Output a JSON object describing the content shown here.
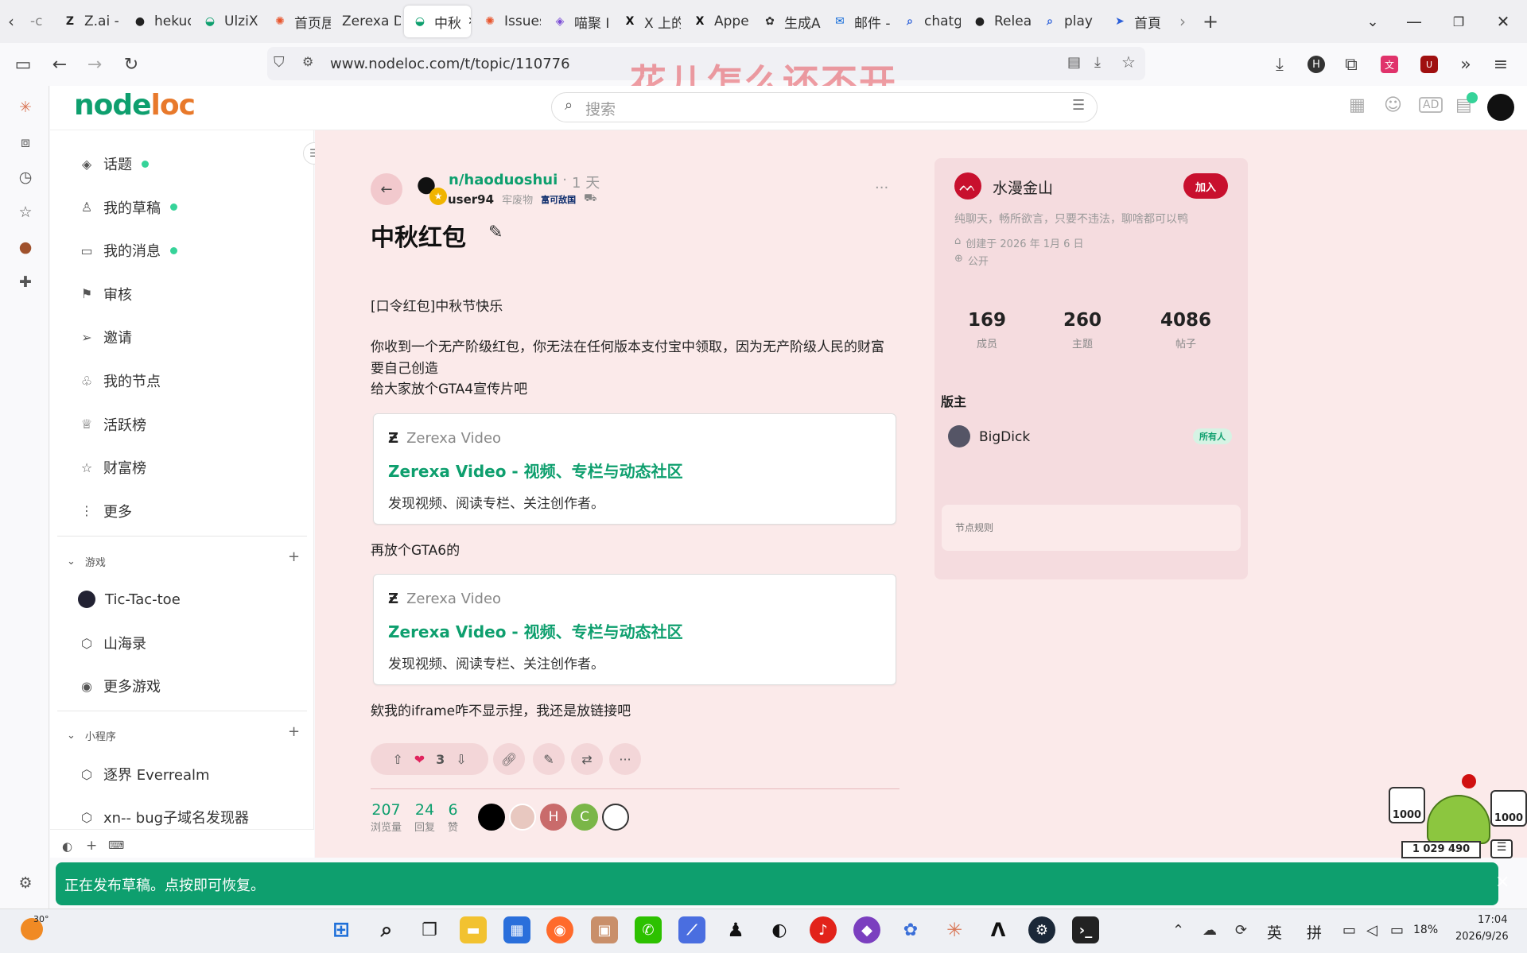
{
  "browser": {
    "tabs": [
      {
        "label": "Z.ai -",
        "icon": "zai-icon",
        "color": "#222"
      },
      {
        "label": "hekuc",
        "icon": "github-icon",
        "color": "#222"
      },
      {
        "label": "UlziX",
        "icon": "nodeloc-icon",
        "color": "#0e9f6e"
      },
      {
        "label": "首页居",
        "icon": "nodeloc-orange-icon",
        "color": "#e8552d"
      },
      {
        "label": "Zerexa Dc",
        "icon": "",
        "color": ""
      },
      {
        "label": "中秋",
        "icon": "nodeloc-icon",
        "color": "#0e9f6e",
        "active": true
      },
      {
        "label": "Issues",
        "icon": "issues-icon",
        "color": "#e8552d"
      },
      {
        "label": "喵聚 I",
        "icon": "cat-icon",
        "color": "#7b4dd6"
      },
      {
        "label": "X 上的",
        "icon": "x-icon",
        "color": "#111"
      },
      {
        "label": "Appe",
        "icon": "x-icon",
        "color": "#111"
      },
      {
        "label": "生成A",
        "icon": "openai-icon",
        "color": "#333"
      },
      {
        "label": "邮件 -",
        "icon": "mail-icon",
        "color": "#0a66d8"
      },
      {
        "label": "chatg",
        "icon": "search-icon",
        "color": "#2b5fd9"
      },
      {
        "label": "Relea",
        "icon": "github-icon",
        "color": "#222"
      },
      {
        "label": "play",
        "icon": "search-icon",
        "color": "#2b5fd9"
      },
      {
        "label": "首頁",
        "icon": "arrow-icon",
        "color": "#2b5fd9"
      }
    ],
    "url": "www.nodeloc.com/t/topic/110776",
    "watermark": "花儿怎么还不开"
  },
  "site": {
    "logo_left": "node",
    "logo_right": "loc",
    "search_placeholder": "搜索"
  },
  "sidebar": {
    "items": [
      {
        "label": "话题",
        "icon": "layers-icon",
        "dot": true
      },
      {
        "label": "我的草稿",
        "icon": "user-icon",
        "dot": true
      },
      {
        "label": "我的消息",
        "icon": "inbox-icon",
        "dot": true
      },
      {
        "label": "审核",
        "icon": "flag-icon",
        "dot": false
      },
      {
        "label": "邀请",
        "icon": "send-icon",
        "dot": false
      },
      {
        "label": "我的节点",
        "icon": "users-icon",
        "dot": false
      },
      {
        "label": "活跃榜",
        "icon": "trophy-icon",
        "dot": false
      },
      {
        "label": "财富榜",
        "icon": "star-icon",
        "dot": false
      },
      {
        "label": "更多",
        "icon": "more-icon",
        "dot": false
      }
    ],
    "games_title": "游戏",
    "games": [
      {
        "label": "Tic-Tac-toe"
      },
      {
        "label": "山海录"
      },
      {
        "label": "更多游戏"
      }
    ],
    "mini_title": "小程序",
    "mini": [
      {
        "label": "逐界 Everrealm"
      },
      {
        "label": "xn-- bug子域名发现器"
      }
    ]
  },
  "post": {
    "node": "n/haoduoshui",
    "time": "1 天",
    "author": "user94",
    "author_title": "牢废物",
    "author_badge": "富可敌国",
    "title": "中秋红包",
    "p1": "[口令红包]中秋节快乐",
    "p2a": "你收到一个无产阶级红包，你无法在任何版本支付宝中领取，因为无产阶级人民的财富",
    "p2b": "要自己创造",
    "p3": "给大家放个GTA4宣传片吧",
    "onebox1": {
      "source": "Zerexa Video",
      "title": "Zerexa Video - 视频、专栏与动态社区",
      "desc": "发现视频、阅读专栏、关注创作者。"
    },
    "p4": "再放个GTA6的",
    "onebox2": {
      "source": "Zerexa Video",
      "title": "Zerexa Video - 视频、专栏与动态社区",
      "desc": "发现视频、阅读专栏、关注创作者。"
    },
    "p5": "欸我的iframe咋不显示捏，我还是放链接吧",
    "likes": "3",
    "views": "207",
    "views_label": "浏览量",
    "replies": "24",
    "replies_label": "回复",
    "likes_total": "6",
    "likes_label": "赞"
  },
  "node_card": {
    "name": "水漫金山",
    "join": "加入",
    "desc": "纯聊天，畅所欲言，只要不违法，聊啥都可以鸭",
    "created": "创建于 2026 年 1月 6 日",
    "visibility": "公开",
    "members": "169",
    "members_label": "成员",
    "topics": "260",
    "topics_label": "主题",
    "posts": "4086",
    "posts_label": "帖子",
    "mods_title": "版主",
    "mod_name": "BigDick",
    "mod_role": "所有人",
    "rules": "节点规则"
  },
  "pet": {
    "left_count": "1000",
    "right_count": "1000",
    "total": "1 029 490"
  },
  "toast": {
    "text": "正在发布草稿。点按即可恢复。",
    "close": "×"
  },
  "taskbar": {
    "weather": "30°",
    "lang1": "英",
    "lang2": "拼",
    "battery": "18%",
    "time": "17:04",
    "date": "2026/9/26"
  },
  "colors": {
    "brand_green": "#0e9f6e",
    "brand_orange": "#e8792b",
    "main_bg": "#fbeaea",
    "join_red": "#c8102e"
  }
}
